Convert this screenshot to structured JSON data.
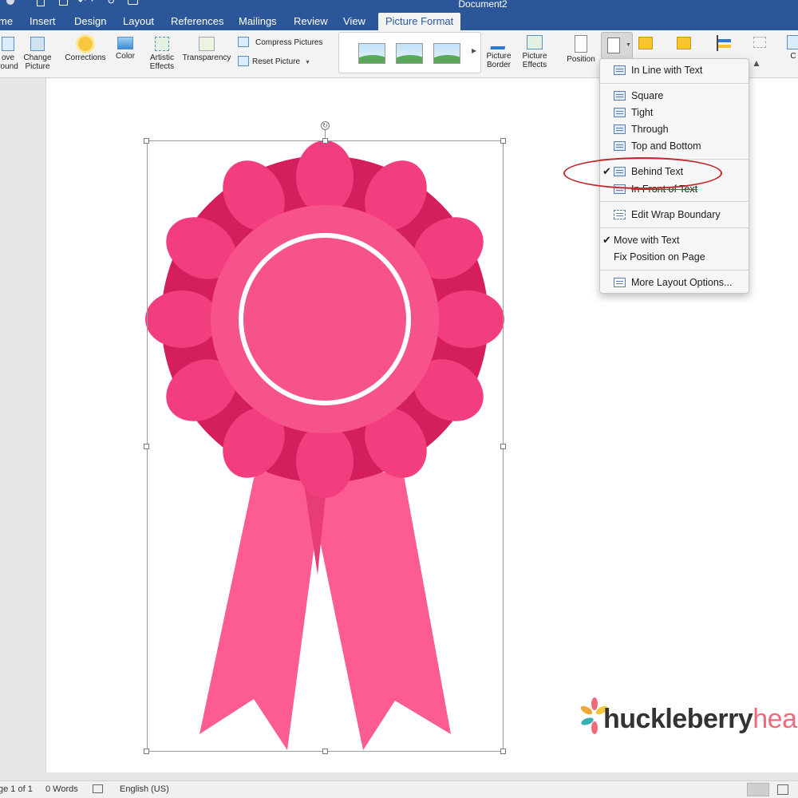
{
  "window": {
    "title": "Document2"
  },
  "tabs": [
    {
      "label": "me"
    },
    {
      "label": "Insert"
    },
    {
      "label": "Design"
    },
    {
      "label": "Layout"
    },
    {
      "label": "References"
    },
    {
      "label": "Mailings"
    },
    {
      "label": "Review"
    },
    {
      "label": "View"
    },
    {
      "label": "Picture Format"
    }
  ],
  "active_tab": "Picture Format",
  "ribbon": {
    "remove_background": [
      "ove",
      "round"
    ],
    "change_picture": [
      "Change",
      "Picture"
    ],
    "corrections": "Corrections",
    "color": "Color",
    "artistic_effects": [
      "Artistic",
      "Effects"
    ],
    "transparency": "Transparency",
    "compress_pictures": "Compress Pictures",
    "reset_picture": "Reset Picture",
    "picture_border": [
      "Picture",
      "Border"
    ],
    "picture_effects": [
      "Picture",
      "Effects"
    ],
    "position": "Position",
    "crop_partial": "C"
  },
  "wrap_menu": {
    "in_line": "In Line with Text",
    "square": "Square",
    "tight": "Tight",
    "through": "Through",
    "top_bottom": "Top and Bottom",
    "behind_text": "Behind Text",
    "in_front": "In Front of Text",
    "edit_wrap": "Edit Wrap Boundary",
    "move_with_text": "Move with Text",
    "fix_position": "Fix Position on Page",
    "more_layout": "More Layout Options...",
    "checked_items": [
      "Behind Text",
      "Move with Text"
    ]
  },
  "status": {
    "page": "ge 1 of 1",
    "words": "0 Words",
    "language": "English (US)"
  },
  "logo": {
    "part1": "huckleberry",
    "part2": "hearts"
  },
  "colors": {
    "title_bar": "#2b579a",
    "ribbon_petal_light": "#f23d7e",
    "ribbon_petal_dark": "#d41f5c",
    "ribbon_center": "#f7538b",
    "ribbon_tail": "#fc5c8f",
    "annotation": "#c1272d",
    "logo_accent": "#ef6a7a"
  }
}
